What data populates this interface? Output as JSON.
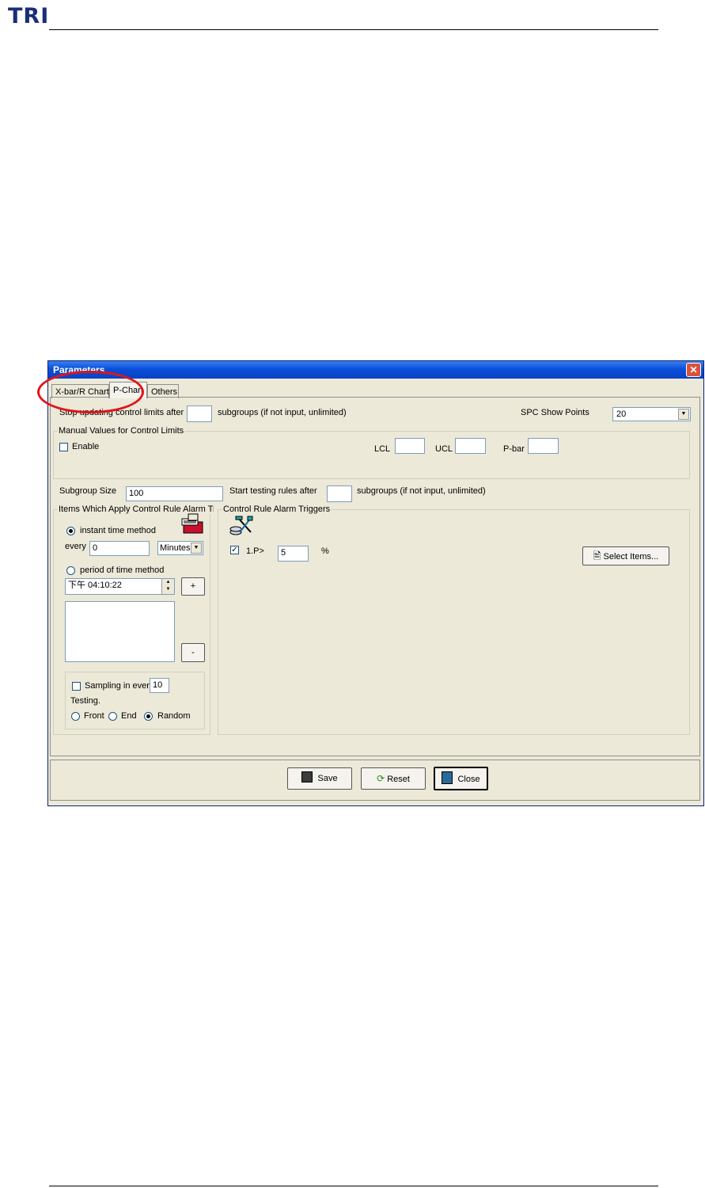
{
  "header": {
    "logo_text": "TRI"
  },
  "dialog": {
    "title": "Parameters",
    "close_glyph": "✕",
    "tabs": [
      {
        "label": "X-bar/R Chart",
        "active": false
      },
      {
        "label": "P-Chart",
        "active": true
      },
      {
        "label": "Others",
        "active": false
      }
    ],
    "stop_updating_label": "Stop updating control limits after",
    "stop_updating_value": "",
    "stop_updating_suffix": "subgroups (if not input, unlimited)",
    "spc_show_points_label": "SPC Show Points",
    "spc_show_points_value": "20",
    "manual": {
      "group_title": "Manual Values for Control Limits",
      "enable_label": "Enable",
      "enable_checked": false,
      "lcl_label": "LCL",
      "ucl_label": "UCL",
      "pbar_label": "P-bar",
      "lcl_value": "",
      "ucl_value": "",
      "pbar_value": ""
    },
    "subgroup_size_label": "Subgroup Size",
    "subgroup_size_value": "100",
    "start_testing_label": "Start testing rules after",
    "start_testing_value": "",
    "start_testing_suffix": "subgroups (if not input, unlimited)",
    "items_group": {
      "title": "Items Which Apply Control Rule Alarm Trigg",
      "instant_label": "instant time method",
      "every_label": "every",
      "every_value": "0",
      "unit_value": "Minutes",
      "period_label": "period of time method",
      "time_value": "下午 04:10:22",
      "add_label": "+",
      "remove_label": "-",
      "sampling_label": "Sampling in every",
      "sampling_value": "10",
      "testing_label": "Testing.",
      "front_label": "Front",
      "end_label": "End",
      "random_label": "Random",
      "selected_mode": "Random"
    },
    "triggers_group": {
      "title": "Control Rule Alarm Triggers",
      "rule_label": "1.P>",
      "rule_checked": true,
      "rule_value": "5",
      "percent_label": "%",
      "select_items_label": "Select Items..."
    },
    "buttons": {
      "save": "Save",
      "reset": "Reset",
      "close": "Close"
    }
  },
  "colors": {
    "annotation_ellipse": "#e0141c",
    "dialog_bg": "#ece9d8",
    "titlebar": "#0a4fd8"
  }
}
